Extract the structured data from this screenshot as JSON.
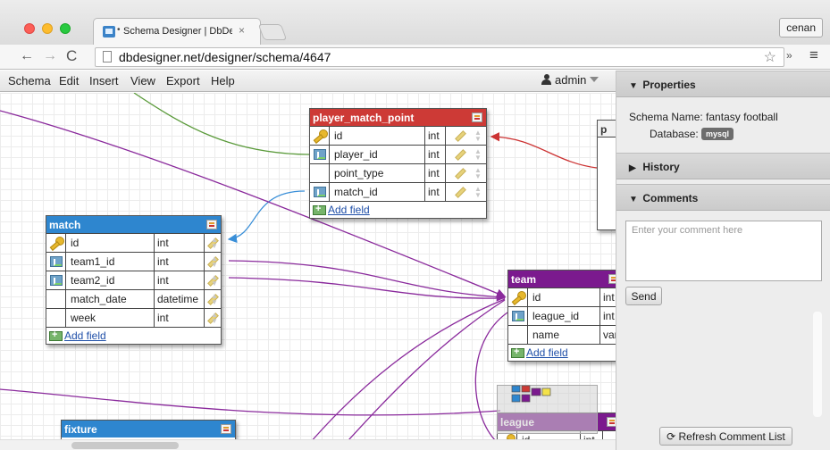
{
  "browser": {
    "tab_title": "Schema Designer | DbDesigner",
    "tab_dot": "•",
    "tab_close": "×",
    "user_chip": "cenan",
    "url": "dbdesigner.net/designer/schema/4647",
    "icons": {
      "back": "←",
      "forward": "→",
      "reload": "C",
      "star": "☆",
      "extensions": "»",
      "menu": "≡"
    }
  },
  "menubar": {
    "items": [
      "Schema",
      "Edit",
      "Insert",
      "View",
      "Export",
      "Help"
    ],
    "user": "admin"
  },
  "tables": [
    {
      "id": "player_match_point",
      "name": "player_match_point",
      "color": "#cd3a36",
      "fields": [
        {
          "name": "id",
          "type": "int",
          "key": "pk"
        },
        {
          "name": "player_id",
          "type": "int",
          "key": "fk"
        },
        {
          "name": "point_type",
          "type": "int",
          "key": ""
        },
        {
          "name": "match_id",
          "type": "int",
          "key": "fk"
        }
      ]
    },
    {
      "id": "match",
      "name": "match",
      "color": "#2e86cf",
      "fields": [
        {
          "name": "id",
          "type": "int",
          "key": "pk"
        },
        {
          "name": "team1_id",
          "type": "int",
          "key": "fk"
        },
        {
          "name": "team2_id",
          "type": "int",
          "key": "fk"
        },
        {
          "name": "match_date",
          "type": "datetime",
          "key": ""
        },
        {
          "name": "week",
          "type": "int",
          "key": ""
        }
      ]
    },
    {
      "id": "team",
      "name": "team",
      "color": "#7b1a8e",
      "fields": [
        {
          "name": "id",
          "type": "int",
          "key": "pk"
        },
        {
          "name": "league_id",
          "type": "int",
          "key": "fk"
        },
        {
          "name": "name",
          "type": "varc",
          "key": ""
        }
      ]
    },
    {
      "id": "fixture",
      "name": "fixture",
      "color": "#2e86cf",
      "fields": []
    },
    {
      "id": "league",
      "name": "league",
      "color": "#7b1a8e",
      "fields": [
        {
          "name": "id",
          "type": "int",
          "key": "pk"
        }
      ]
    },
    {
      "id": "player_partial",
      "name": "p",
      "color": "#f2f2f2",
      "fields": []
    }
  ],
  "add_field_label": "Add field",
  "sidebar": {
    "properties_label": "Properties",
    "schema_name_label": "Schema Name:",
    "schema_name": "fantasy football",
    "database_label": "Database:",
    "database": "mysql",
    "history_label": "History",
    "comments_label": "Comments",
    "comment_placeholder": "Enter your comment here",
    "send_label": "Send",
    "refresh_label": "Refresh Comment List"
  },
  "colors": {
    "connector_purple": "#8a2a9c",
    "connector_green": "#5a9a3a",
    "connector_blue": "#3a8fd8",
    "connector_red": "#cc3333"
  }
}
